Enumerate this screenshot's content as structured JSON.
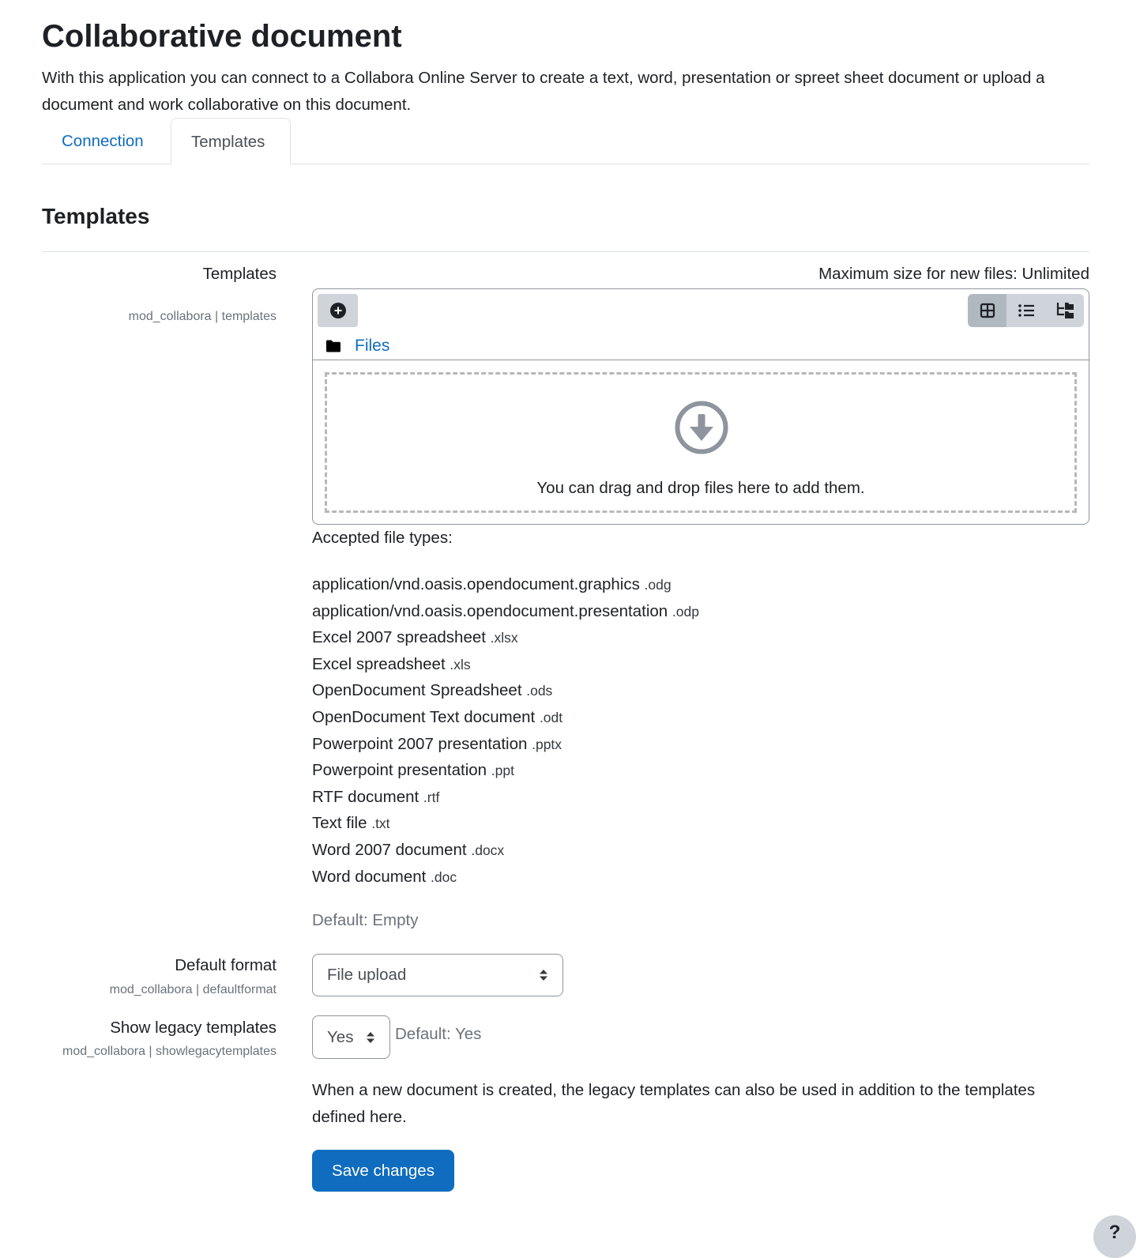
{
  "page": {
    "title": "Collaborative document",
    "intro": "With this application you can connect to a Collabora Online Server to create a text, word, presentation or spreet sheet document or upload a document and work collaborative on this document."
  },
  "tabs": [
    {
      "label": "Connection",
      "active": false
    },
    {
      "label": "Templates",
      "active": true
    }
  ],
  "section": {
    "heading": "Templates"
  },
  "templates_setting": {
    "label": "Templates",
    "key": "mod_collabora | templates",
    "max_size": "Maximum size for new files: Unlimited",
    "filemanager": {
      "add_icon": "plus-circle-icon",
      "views": [
        {
          "icon": "grid-view-icon",
          "active": true
        },
        {
          "icon": "list-view-icon",
          "active": false
        },
        {
          "icon": "tree-view-icon",
          "active": false
        }
      ],
      "path_icon": "folder-icon",
      "path_label": "Files",
      "drop_icon": "download-circle-icon",
      "drop_text": "You can drag and drop files here to add them."
    },
    "accepted_title": "Accepted file types:",
    "accepted_types": [
      {
        "name": "application/vnd.oasis.opendocument.graphics",
        "ext": ".odg"
      },
      {
        "name": "application/vnd.oasis.opendocument.presentation",
        "ext": ".odp"
      },
      {
        "name": "Excel 2007 spreadsheet",
        "ext": ".xlsx"
      },
      {
        "name": "Excel spreadsheet",
        "ext": ".xls"
      },
      {
        "name": "OpenDocument Spreadsheet",
        "ext": ".ods"
      },
      {
        "name": "OpenDocument Text document",
        "ext": ".odt"
      },
      {
        "name": "Powerpoint 2007 presentation",
        "ext": ".pptx"
      },
      {
        "name": "Powerpoint presentation",
        "ext": ".ppt"
      },
      {
        "name": "RTF document",
        "ext": ".rtf"
      },
      {
        "name": "Text file",
        "ext": ".txt"
      },
      {
        "name": "Word 2007 document",
        "ext": ".docx"
      },
      {
        "name": "Word document",
        "ext": ".doc"
      }
    ],
    "default": "Default: Empty"
  },
  "default_format": {
    "label": "Default format",
    "key": "mod_collabora | defaultformat",
    "value": "File upload"
  },
  "legacy_templates": {
    "label": "Show legacy templates",
    "key": "mod_collabora | showlegacytemplates",
    "value": "Yes",
    "default": "Default: Yes",
    "description": "When a new document is created, the legacy templates can also be used in addition to the templates defined here."
  },
  "save_label": "Save changes",
  "help_label": "?",
  "colors": {
    "link": "#0f6cbf",
    "primary": "#0f6cbf",
    "muted": "#6a737b"
  }
}
